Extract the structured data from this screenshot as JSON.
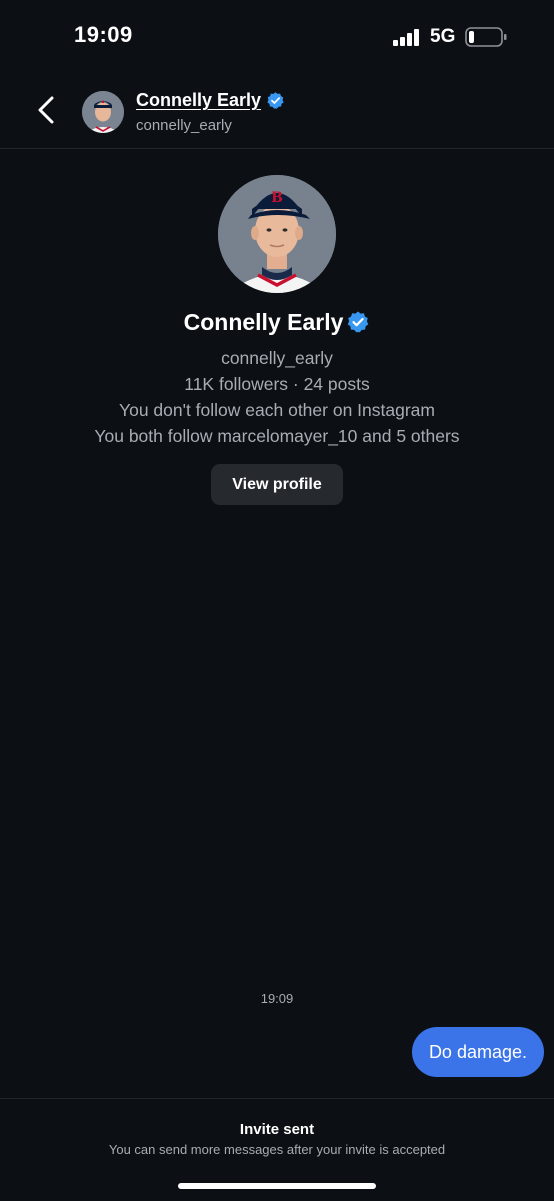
{
  "status_bar": {
    "time": "19:09",
    "network": "5G",
    "signal_icon": "signal-bars-icon",
    "battery_icon": "battery-low-icon",
    "battery_level": 0.15
  },
  "header": {
    "back_icon": "chevron-left-icon",
    "name": "Connelly Early",
    "handle": "connelly_early",
    "verified_icon": "verified-badge-icon"
  },
  "profile": {
    "name": "Connelly Early",
    "handle": "connelly_early",
    "stats": "11K followers · 24 posts",
    "follow_status": "You don't follow each other on Instagram",
    "mutuals": "You both follow marcelomayer_10 and 5 others",
    "view_profile_label": "View profile"
  },
  "messages": {
    "timestamp": "19:09",
    "items": [
      {
        "text": "Do damage.",
        "sender": "me"
      }
    ]
  },
  "footer": {
    "title": "Invite sent",
    "subtitle": "You can send more messages after your invite is accepted"
  },
  "colors": {
    "background": "#0c1014",
    "bubble": "#3a74e8",
    "verified": "#3897f0",
    "secondary_text": "#a8acb3",
    "button_bg": "#26292e"
  }
}
